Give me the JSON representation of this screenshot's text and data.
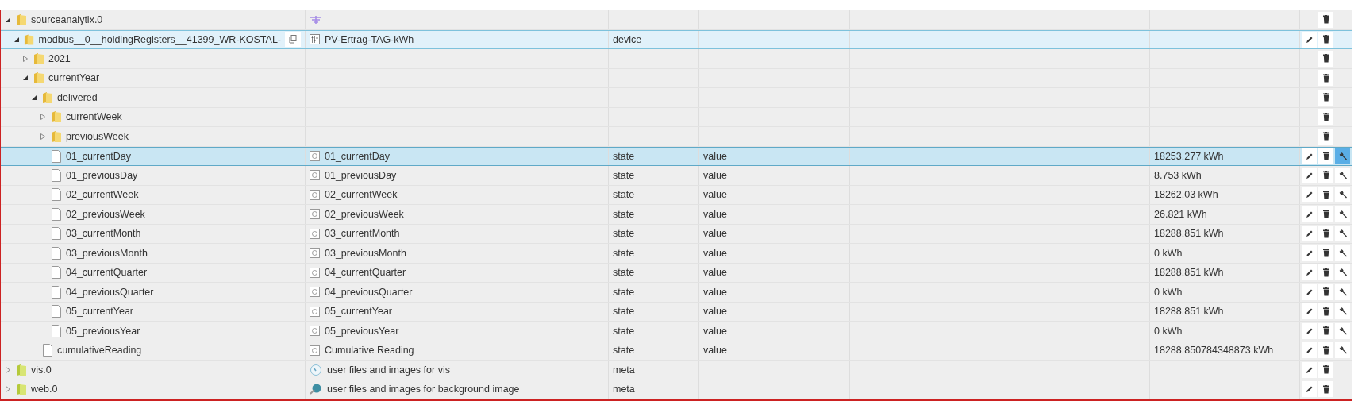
{
  "tree": [
    {
      "name": "sourceanalytix.0",
      "kind": "folder",
      "expanded": true,
      "selected": false,
      "marked": false,
      "editable": false,
      "configurable": false,
      "children": [
        {
          "name": "modbus__0__holdingRegisters__41399_WR-KOSTAL-",
          "kind": "folder",
          "expanded": true,
          "selected": false,
          "marked": true,
          "copy": true,
          "title": "PV-Ertrag-TAG-kWh",
          "type": "device",
          "editable": true,
          "configurable": false,
          "children": [
            {
              "name": "2021",
              "kind": "folder",
              "expanded": false,
              "selected": false,
              "marked": false,
              "editable": false,
              "configurable": false
            },
            {
              "name": "currentYear",
              "kind": "folder",
              "expanded": true,
              "selected": false,
              "marked": false,
              "editable": false,
              "configurable": false,
              "children": [
                {
                  "name": "delivered",
                  "kind": "folder",
                  "expanded": true,
                  "selected": false,
                  "marked": false,
                  "editable": false,
                  "configurable": false,
                  "children": [
                    {
                      "name": "currentWeek",
                      "kind": "folder",
                      "expanded": false,
                      "selected": false,
                      "marked": false,
                      "editable": false,
                      "configurable": false
                    },
                    {
                      "name": "previousWeek",
                      "kind": "folder",
                      "expanded": false,
                      "selected": false,
                      "marked": false,
                      "editable": false,
                      "configurable": false
                    },
                    {
                      "name": "01_currentDay",
                      "kind": "state",
                      "selected": true,
                      "marked": false,
                      "title": "01_currentDay",
                      "type": "state",
                      "role": "value",
                      "value": "18253.277 kWh",
                      "editable": true,
                      "configurable": true
                    },
                    {
                      "name": "01_previousDay",
                      "kind": "state",
                      "selected": false,
                      "marked": false,
                      "title": "01_previousDay",
                      "type": "state",
                      "role": "value",
                      "value": "8.753 kWh",
                      "editable": true,
                      "configurable": true
                    },
                    {
                      "name": "02_currentWeek",
                      "kind": "state",
                      "selected": false,
                      "marked": false,
                      "title": "02_currentWeek",
                      "type": "state",
                      "role": "value",
                      "value": "18262.03 kWh",
                      "editable": true,
                      "configurable": true
                    },
                    {
                      "name": "02_previousWeek",
                      "kind": "state",
                      "selected": false,
                      "marked": false,
                      "title": "02_previousWeek",
                      "type": "state",
                      "role": "value",
                      "value": "26.821 kWh",
                      "editable": true,
                      "configurable": true
                    },
                    {
                      "name": "03_currentMonth",
                      "kind": "state",
                      "selected": false,
                      "marked": false,
                      "title": "03_currentMonth",
                      "type": "state",
                      "role": "value",
                      "value": "18288.851 kWh",
                      "editable": true,
                      "configurable": true
                    },
                    {
                      "name": "03_previousMonth",
                      "kind": "state",
                      "selected": false,
                      "marked": false,
                      "title": "03_previousMonth",
                      "type": "state",
                      "role": "value",
                      "value": "0 kWh",
                      "editable": true,
                      "configurable": true
                    },
                    {
                      "name": "04_currentQuarter",
                      "kind": "state",
                      "selected": false,
                      "marked": false,
                      "title": "04_currentQuarter",
                      "type": "state",
                      "role": "value",
                      "value": "18288.851 kWh",
                      "editable": true,
                      "configurable": true
                    },
                    {
                      "name": "04_previousQuarter",
                      "kind": "state",
                      "selected": false,
                      "marked": false,
                      "title": "04_previousQuarter",
                      "type": "state",
                      "role": "value",
                      "value": "0 kWh",
                      "editable": true,
                      "configurable": true
                    },
                    {
                      "name": "05_currentYear",
                      "kind": "state",
                      "selected": false,
                      "marked": false,
                      "title": "05_currentYear",
                      "type": "state",
                      "role": "value",
                      "value": "18288.851 kWh",
                      "editable": true,
                      "configurable": true
                    },
                    {
                      "name": "05_previousYear",
                      "kind": "state",
                      "selected": false,
                      "marked": false,
                      "title": "05_previousYear",
                      "type": "state",
                      "role": "value",
                      "value": "0 kWh",
                      "editable": true,
                      "configurable": true
                    }
                  ]
                },
                {
                  "name": "cumulativeReading",
                  "kind": "state",
                  "selected": false,
                  "marked": false,
                  "title": "Cumulative Reading",
                  "type": "state",
                  "role": "value",
                  "value": "18288.850784348873 kWh",
                  "editable": true,
                  "configurable": true
                }
              ]
            }
          ]
        }
      ]
    },
    {
      "name": "vis.0",
      "kind": "adapter",
      "expanded": false,
      "selected": false,
      "marked": false,
      "title": "user files and images for vis",
      "type": "meta",
      "editable": true,
      "configurable": false
    },
    {
      "name": "web.0",
      "kind": "adapter",
      "expanded": false,
      "selected": false,
      "marked": false,
      "title": "user files and images for background image",
      "type": "meta",
      "editable": true,
      "configurable": false
    }
  ]
}
